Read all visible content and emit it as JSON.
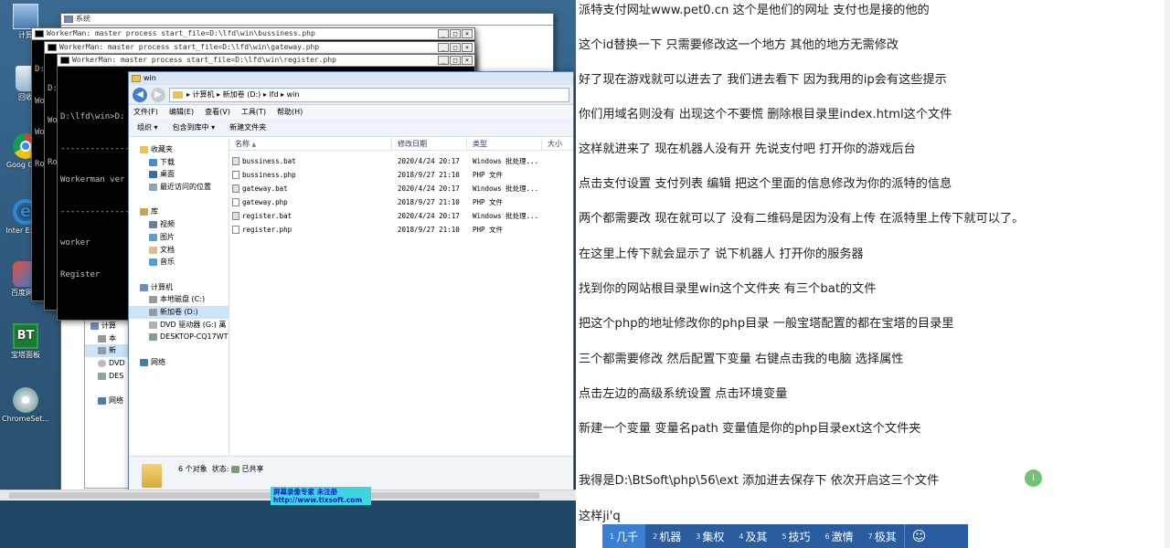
{
  "desktop": {
    "icons": [
      {
        "label": "计算",
        "icon": "computer-icon"
      },
      {
        "label": "回收",
        "icon": "recycle-bin-icon"
      },
      {
        "label": "Goog Chro",
        "icon": "chrome-icon"
      },
      {
        "label": "Inter Explo",
        "icon": "ie-icon"
      },
      {
        "label": "百度网盘",
        "icon": "baidu-netdisk-icon"
      },
      {
        "label": "宝塔面板",
        "icon": "bt-panel-icon"
      },
      {
        "label": "ChromeSet...",
        "icon": "chromeset-icon"
      }
    ],
    "bt_logo_text": "BT"
  },
  "system_window": {
    "title": "系统"
  },
  "cmd_windows": [
    {
      "title": "WorkerMan: master process  start_file=D:\\lfd\\win\\bussiness.php",
      "lines": [
        "D:",
        "Wo",
        "Wo",
        "Ro"
      ]
    },
    {
      "title": "WorkerMan: master process  start_file=D:\\lfd\\win\\gateway.php",
      "lines": [
        "D:",
        "Wo",
        "Ro"
      ]
    },
    {
      "title": "WorkerMan: master process  start_file=D:\\lfd\\win\\register.php",
      "lines": [
        "",
        "D:\\lfd\\win>D:",
        "--------------",
        "Workerman ver",
        "--------------",
        "worker",
        "Register"
      ]
    }
  ],
  "background_explorer": {
    "items": [
      "计算",
      "本",
      "新",
      "DVD",
      "DES",
      "网络"
    ]
  },
  "explorer": {
    "title": "win",
    "address": "▸ 计算机 ▸ 新加卷 (D:) ▸ lfd ▸ win",
    "menu": [
      "文件(F)",
      "编辑(E)",
      "查看(V)",
      "工具(T)",
      "帮助(H)"
    ],
    "toolbar": [
      "组织 ▾",
      "包含到库中 ▾",
      "新建文件夹"
    ],
    "nav": [
      {
        "label": "收藏夹",
        "icon": "star-icon",
        "indent": 0
      },
      {
        "label": "下载",
        "icon": "download-folder-icon",
        "indent": 1
      },
      {
        "label": "桌面",
        "icon": "desktop-icon",
        "indent": 1
      },
      {
        "label": "最近访问的位置",
        "icon": "recent-places-icon",
        "indent": 1
      },
      {
        "label": "",
        "icon": "",
        "indent": 0
      },
      {
        "label": "库",
        "icon": "library-icon",
        "indent": 0
      },
      {
        "label": "视频",
        "icon": "video-icon",
        "indent": 1
      },
      {
        "label": "图片",
        "icon": "pictures-icon",
        "indent": 1
      },
      {
        "label": "文档",
        "icon": "documents-icon",
        "indent": 1
      },
      {
        "label": "音乐",
        "icon": "music-icon",
        "indent": 1
      },
      {
        "label": "",
        "icon": "",
        "indent": 0
      },
      {
        "label": "计算机",
        "icon": "computer-icon",
        "indent": 0
      },
      {
        "label": "本地磁盘 (C:)",
        "icon": "drive-icon",
        "indent": 1
      },
      {
        "label": "新加卷 (D:)",
        "icon": "drive-icon",
        "indent": 1,
        "selected": true
      },
      {
        "label": "DVD 驱动器 (G:) 萬",
        "icon": "dvd-icon",
        "indent": 1
      },
      {
        "label": "DESKTOP-CQ17WTQ 上",
        "icon": "network-drive-icon",
        "indent": 1
      },
      {
        "label": "",
        "icon": "",
        "indent": 0
      },
      {
        "label": "网络",
        "icon": "network-icon",
        "indent": 0
      }
    ],
    "columns": [
      "名称",
      "修改日期",
      "类型",
      "大小"
    ],
    "files": [
      {
        "name": "bussiness.bat",
        "date": "2020/4/24 20:17",
        "type": "Windows 批处理...",
        "kind": "bat"
      },
      {
        "name": "bussiness.php",
        "date": "2018/9/27 21:10",
        "type": "PHP 文件",
        "kind": "php"
      },
      {
        "name": "gateway.bat",
        "date": "2020/4/24 20:17",
        "type": "Windows 批处理...",
        "kind": "bat"
      },
      {
        "name": "gateway.php",
        "date": "2018/9/27 21:10",
        "type": "PHP 文件",
        "kind": "php"
      },
      {
        "name": "register.bat",
        "date": "2020/4/24 20:17",
        "type": "Windows 批处理...",
        "kind": "bat"
      },
      {
        "name": "register.php",
        "date": "2018/9/27 21:10",
        "type": "PHP 文件",
        "kind": "php"
      }
    ],
    "status": {
      "count": "6 个对象",
      "state_label": "状态:",
      "state_value": "已共享"
    }
  },
  "watermark": {
    "line1": "屏幕录像专家       未注册",
    "line2": "http://www.tlxsoft.com"
  },
  "doc_lines": [
    "派特支付网址www.pet0.cn  这个是他们的网址 支付也是接的他的",
    "这个id替换一下 只需要修改这一个地方 其他的地方无需修改",
    "好了现在游戏就可以进去了 我们进去看下  因为我用的ip会有这些提示",
    "你们用域名则没有  出现这个不要慌 删除根目录里index.html这个文件",
    "这样就进来了  现在机器人没有开 先说支付吧 打开你的游戏后台",
    "点击支付设置 支付列表 编辑 把这个里面的信息修改为你的派特的信息",
    "两个都需要改 现在就可以了 没有二维码是因为没有上传 在派特里上传下就可以了。",
    "在这里上传下就会显示了  说下机器人  打开你的服务器",
    "找到你的网站根目录里win这个文件夹 有三个bat的文件",
    "把这个php的地址修改你的php目录 一般宝塔配置的都在宝塔的目录里",
    "三个都需要修改 然后配置下变量 右键点击我的电脑 选择属性",
    "点击左边的高级系统设置 点击环境变量",
    "新建一个变量 变量名path   变量值是你的php目录ext这个文件夹",
    "",
    "我得是D:\\BtSoft\\php\\56\\ext 添加进去保存下 依次开启这三个文件",
    "这样ji'q"
  ],
  "cursor_label": "I",
  "ime": {
    "candidates": [
      {
        "num": "1",
        "text": "几千"
      },
      {
        "num": "2",
        "text": "机器"
      },
      {
        "num": "3",
        "text": "集权"
      },
      {
        "num": "4",
        "text": "及其"
      },
      {
        "num": "5",
        "text": "技巧"
      },
      {
        "num": "6",
        "text": "激情"
      },
      {
        "num": "7",
        "text": "极其"
      }
    ],
    "emoji": "☺"
  },
  "colors": {
    "accent": "#3f7fd1",
    "ime": "#2a5d9f",
    "cursor": "#5cb85c"
  }
}
